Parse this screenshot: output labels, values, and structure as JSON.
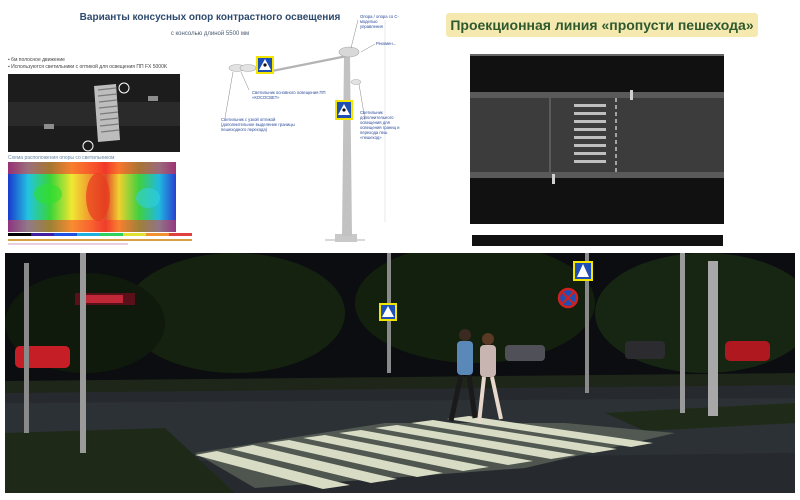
{
  "poles_panel": {
    "title": "Варианты консусных опор контрастного освещения",
    "subtitle": "с консолью длиной 5500 мм",
    "bullets": [
      "6м полосное движение",
      "Используются светильники с оптикой для освещения ПП FX 5000K"
    ],
    "heatmap_caption": "Схема расположения опоры со светильником",
    "notes": {
      "top_right": "Опора / опора со С-моделью управления",
      "mid_right": "Рекомен...",
      "center": "Светильник основного освещения ПП «КОСОСВЕТ»",
      "lower_left": "Светильник с узкой оптикой (дополнительное выделение границы пешеходного перехода)",
      "lower_right": "Светильник дополнительного освещения для освещения границ и перехода пеш «пешеход»"
    }
  },
  "projection_panel": {
    "title": "Проекционная линия «пропусти пешехода»"
  },
  "colors": {
    "title_blue": "#2d4a6e",
    "projection_title_bg": "#f6e9b0",
    "projection_title_text": "#2e5a2e",
    "crosswalk_sign": "#1e4fb5",
    "sign_border": "#f2e600"
  },
  "icons": [
    "pedestrian-crossing-sign-icon",
    "no-stopping-sign-icon",
    "streetlight-icon"
  ]
}
